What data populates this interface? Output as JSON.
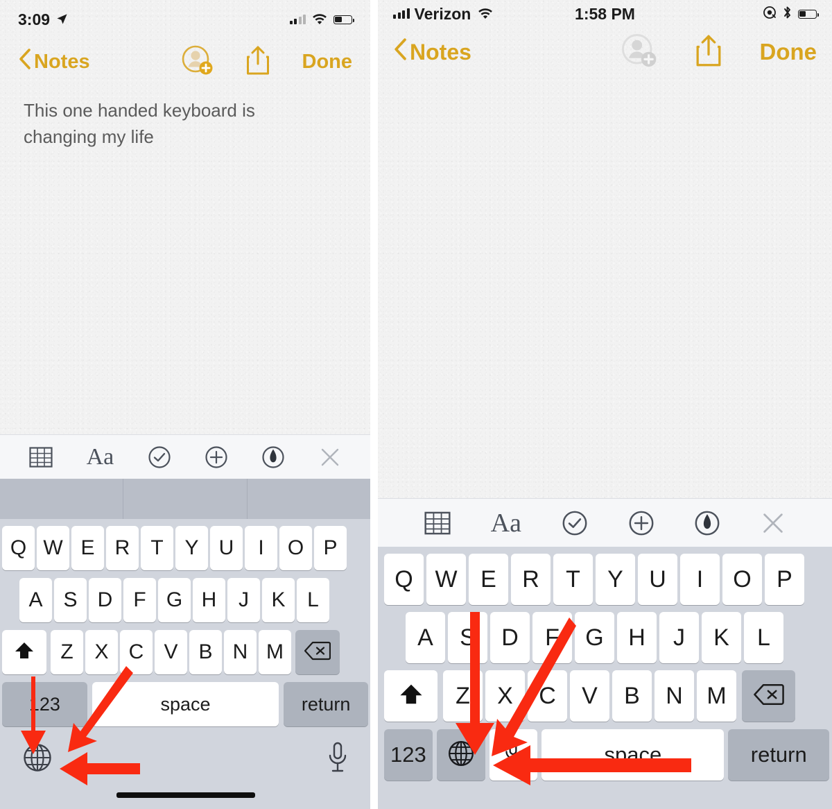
{
  "meta": {
    "accent_gold": "#d9a520",
    "arrow_red": "#f92a11",
    "paper_bg": "#f2f2f2",
    "keyboard_bg": "#d1d5dd",
    "key_white": "#ffffff",
    "key_gray": "#adb3bd",
    "suggestion_bar_bg": "#b9bec8",
    "toolbar_bg": "#f6f7f9"
  },
  "left_panel": {
    "status_bar": {
      "time": "3:09",
      "location_icon": "location-arrow-icon",
      "signal_icon": "cellular-signal-icon",
      "signal_bars_filled": 2,
      "signal_bars_total": 4,
      "wifi_icon": "wifi-icon",
      "battery_icon": "battery-icon",
      "battery_level_percent": 42
    },
    "nav_bar": {
      "back_chevron_icon": "chevron-left-icon",
      "back_label": "Notes",
      "add_person_icon": "add-person-icon",
      "share_icon": "share-upload-icon",
      "done_label": "Done"
    },
    "note": {
      "body": "This one handed keyboard is changing my life"
    },
    "accessory_toolbar": {
      "items": [
        {
          "icon": "table-icon",
          "label": ""
        },
        {
          "icon": "text-format-icon",
          "label": "Aa"
        },
        {
          "icon": "checklist-circle-icon",
          "label": ""
        },
        {
          "icon": "add-circle-icon",
          "label": ""
        },
        {
          "icon": "markup-pen-icon",
          "label": ""
        },
        {
          "icon": "close-x-icon",
          "label": ""
        }
      ]
    },
    "suggestion_bar": {
      "suggestions": [
        "",
        "",
        ""
      ]
    },
    "keyboard": {
      "layout_mode": "full-width",
      "row1": [
        "Q",
        "W",
        "E",
        "R",
        "T",
        "Y",
        "U",
        "I",
        "O",
        "P"
      ],
      "row2": [
        "A",
        "S",
        "D",
        "F",
        "G",
        "H",
        "J",
        "K",
        "L"
      ],
      "row3": [
        "Z",
        "X",
        "C",
        "V",
        "B",
        "N",
        "M"
      ],
      "shift_icon": "shift-arrow-icon",
      "backspace_icon": "backspace-delete-icon",
      "numbers_label": "123",
      "space_label": "space",
      "return_label": "return",
      "globe_icon": "globe-keyboard-switch-icon",
      "mic_icon": "microphone-dictation-icon",
      "home_indicator": "home-indicator-bar"
    },
    "annotations": [
      {
        "name": "arrow-to-globe-key-down",
        "direction": "down"
      },
      {
        "name": "arrow-to-globe-key-diagonal",
        "direction": "down-left"
      },
      {
        "name": "arrow-to-globe-key-left",
        "direction": "left"
      }
    ]
  },
  "right_panel": {
    "status_bar": {
      "signal_icon": "cellular-signal-icon",
      "signal_bars_filled": 4,
      "signal_bars_total": 4,
      "carrier": "Verizon",
      "wifi_icon": "wifi-icon",
      "time": "1:58 PM",
      "rotation_lock_icon": "rotation-lock-icon",
      "bluetooth_icon": "bluetooth-icon",
      "battery_icon": "battery-icon",
      "battery_level_percent": 38
    },
    "nav_bar": {
      "back_chevron_icon": "chevron-left-icon",
      "back_label": "Notes",
      "add_person_icon": "add-person-icon",
      "add_person_disabled": true,
      "share_icon": "share-upload-icon",
      "done_label": "Done"
    },
    "note": {
      "body": ""
    },
    "accessory_toolbar": {
      "items": [
        {
          "icon": "table-icon",
          "label": ""
        },
        {
          "icon": "text-format-icon",
          "label": "Aa"
        },
        {
          "icon": "checklist-circle-icon",
          "label": ""
        },
        {
          "icon": "add-circle-icon",
          "label": ""
        },
        {
          "icon": "markup-pen-icon",
          "label": ""
        },
        {
          "icon": "close-x-icon",
          "label": ""
        }
      ]
    },
    "keyboard": {
      "layout_mode": "one-handed-right",
      "row1": [
        "Q",
        "W",
        "E",
        "R",
        "T",
        "Y",
        "U",
        "I",
        "O",
        "P"
      ],
      "row2": [
        "A",
        "S",
        "D",
        "F",
        "G",
        "H",
        "J",
        "K",
        "L"
      ],
      "row3": [
        "Z",
        "X",
        "C",
        "V",
        "B",
        "N",
        "M"
      ],
      "shift_icon": "shift-arrow-icon",
      "backspace_icon": "backspace-delete-icon",
      "numbers_label": "123",
      "globe_icon": "globe-keyboard-switch-icon",
      "mic_icon": "microphone-dictation-icon",
      "space_label": "space",
      "return_label": "return"
    },
    "annotations": [
      {
        "name": "arrow-to-globe-key-down",
        "direction": "down"
      },
      {
        "name": "arrow-to-mic-key-diagonal",
        "direction": "down-left"
      },
      {
        "name": "arrow-to-mic-key-left",
        "direction": "left"
      }
    ]
  }
}
